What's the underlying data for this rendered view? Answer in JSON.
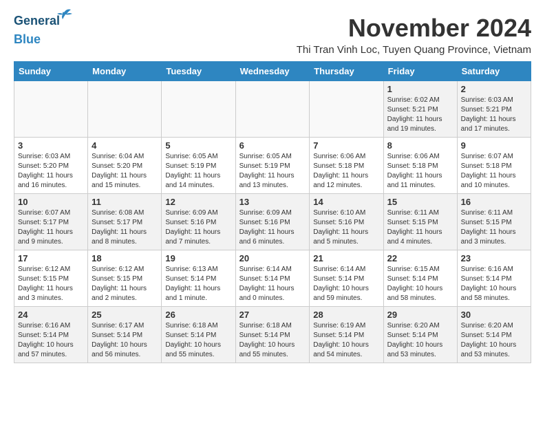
{
  "logo": {
    "line1": "General",
    "line2": "Blue"
  },
  "title": "November 2024",
  "subtitle": "Thi Tran Vinh Loc, Tuyen Quang Province, Vietnam",
  "headers": [
    "Sunday",
    "Monday",
    "Tuesday",
    "Wednesday",
    "Thursday",
    "Friday",
    "Saturday"
  ],
  "weeks": [
    [
      {
        "day": "",
        "info": ""
      },
      {
        "day": "",
        "info": ""
      },
      {
        "day": "",
        "info": ""
      },
      {
        "day": "",
        "info": ""
      },
      {
        "day": "",
        "info": ""
      },
      {
        "day": "1",
        "info": "Sunrise: 6:02 AM\nSunset: 5:21 PM\nDaylight: 11 hours and 19 minutes."
      },
      {
        "day": "2",
        "info": "Sunrise: 6:03 AM\nSunset: 5:21 PM\nDaylight: 11 hours and 17 minutes."
      }
    ],
    [
      {
        "day": "3",
        "info": "Sunrise: 6:03 AM\nSunset: 5:20 PM\nDaylight: 11 hours and 16 minutes."
      },
      {
        "day": "4",
        "info": "Sunrise: 6:04 AM\nSunset: 5:20 PM\nDaylight: 11 hours and 15 minutes."
      },
      {
        "day": "5",
        "info": "Sunrise: 6:05 AM\nSunset: 5:19 PM\nDaylight: 11 hours and 14 minutes."
      },
      {
        "day": "6",
        "info": "Sunrise: 6:05 AM\nSunset: 5:19 PM\nDaylight: 11 hours and 13 minutes."
      },
      {
        "day": "7",
        "info": "Sunrise: 6:06 AM\nSunset: 5:18 PM\nDaylight: 11 hours and 12 minutes."
      },
      {
        "day": "8",
        "info": "Sunrise: 6:06 AM\nSunset: 5:18 PM\nDaylight: 11 hours and 11 minutes."
      },
      {
        "day": "9",
        "info": "Sunrise: 6:07 AM\nSunset: 5:18 PM\nDaylight: 11 hours and 10 minutes."
      }
    ],
    [
      {
        "day": "10",
        "info": "Sunrise: 6:07 AM\nSunset: 5:17 PM\nDaylight: 11 hours and 9 minutes."
      },
      {
        "day": "11",
        "info": "Sunrise: 6:08 AM\nSunset: 5:17 PM\nDaylight: 11 hours and 8 minutes."
      },
      {
        "day": "12",
        "info": "Sunrise: 6:09 AM\nSunset: 5:16 PM\nDaylight: 11 hours and 7 minutes."
      },
      {
        "day": "13",
        "info": "Sunrise: 6:09 AM\nSunset: 5:16 PM\nDaylight: 11 hours and 6 minutes."
      },
      {
        "day": "14",
        "info": "Sunrise: 6:10 AM\nSunset: 5:16 PM\nDaylight: 11 hours and 5 minutes."
      },
      {
        "day": "15",
        "info": "Sunrise: 6:11 AM\nSunset: 5:15 PM\nDaylight: 11 hours and 4 minutes."
      },
      {
        "day": "16",
        "info": "Sunrise: 6:11 AM\nSunset: 5:15 PM\nDaylight: 11 hours and 3 minutes."
      }
    ],
    [
      {
        "day": "17",
        "info": "Sunrise: 6:12 AM\nSunset: 5:15 PM\nDaylight: 11 hours and 3 minutes."
      },
      {
        "day": "18",
        "info": "Sunrise: 6:12 AM\nSunset: 5:15 PM\nDaylight: 11 hours and 2 minutes."
      },
      {
        "day": "19",
        "info": "Sunrise: 6:13 AM\nSunset: 5:14 PM\nDaylight: 11 hours and 1 minute."
      },
      {
        "day": "20",
        "info": "Sunrise: 6:14 AM\nSunset: 5:14 PM\nDaylight: 11 hours and 0 minutes."
      },
      {
        "day": "21",
        "info": "Sunrise: 6:14 AM\nSunset: 5:14 PM\nDaylight: 10 hours and 59 minutes."
      },
      {
        "day": "22",
        "info": "Sunrise: 6:15 AM\nSunset: 5:14 PM\nDaylight: 10 hours and 58 minutes."
      },
      {
        "day": "23",
        "info": "Sunrise: 6:16 AM\nSunset: 5:14 PM\nDaylight: 10 hours and 58 minutes."
      }
    ],
    [
      {
        "day": "24",
        "info": "Sunrise: 6:16 AM\nSunset: 5:14 PM\nDaylight: 10 hours and 57 minutes."
      },
      {
        "day": "25",
        "info": "Sunrise: 6:17 AM\nSunset: 5:14 PM\nDaylight: 10 hours and 56 minutes."
      },
      {
        "day": "26",
        "info": "Sunrise: 6:18 AM\nSunset: 5:14 PM\nDaylight: 10 hours and 55 minutes."
      },
      {
        "day": "27",
        "info": "Sunrise: 6:18 AM\nSunset: 5:14 PM\nDaylight: 10 hours and 55 minutes."
      },
      {
        "day": "28",
        "info": "Sunrise: 6:19 AM\nSunset: 5:14 PM\nDaylight: 10 hours and 54 minutes."
      },
      {
        "day": "29",
        "info": "Sunrise: 6:20 AM\nSunset: 5:14 PM\nDaylight: 10 hours and 53 minutes."
      },
      {
        "day": "30",
        "info": "Sunrise: 6:20 AM\nSunset: 5:14 PM\nDaylight: 10 hours and 53 minutes."
      }
    ]
  ]
}
